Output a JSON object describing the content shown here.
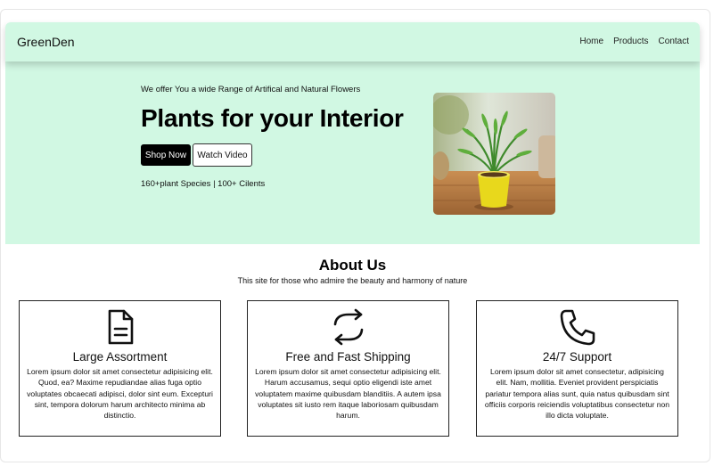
{
  "navbar": {
    "brand": "GreenDen",
    "links": [
      "Home",
      "Products",
      "Contact"
    ]
  },
  "hero": {
    "tagline": "We offer You a wide Range of Artifical and Natural Flowers",
    "title": "Plants for your Interior",
    "shop_label": "Shop Now",
    "watch_label": "Watch Video",
    "stats": "160+plant Species | 100+ Cilents"
  },
  "about": {
    "title": "About Us",
    "subtitle": "This site for those who admire the beauty and harmony of nature",
    "cards": [
      {
        "icon": "document-icon",
        "title": "Large Assortment",
        "text": "Lorem ipsum dolor sit amet consectetur adipisicing elit. Quod, ea? Maxime repudiandae alias fuga optio voluptates obcaecati adipisci, dolor sint eum. Excepturi sint, tempora dolorum harum architecto minima ab distinctio."
      },
      {
        "icon": "refresh-icon",
        "title": "Free and Fast Shipping",
        "text": "Lorem ipsum dolor sit amet consectetur adipisicing elit. Harum accusamus, sequi optio eligendi iste amet voluptatem maxime quibusdam blanditiis. A autem ipsa voluptates sit iusto rem itaque laboriosam quibusdam harum."
      },
      {
        "icon": "phone-icon",
        "title": "24/7 Support",
        "text": "Lorem ipsum dolor sit amet consectetur, adipisicing elit. Nam, mollitia. Eveniet provident perspiciatis pariatur tempora alias sunt, quia natus quibusdam sint officiis corporis reiciendis voluptatibus consectetur non illo dicta voluptate."
      }
    ]
  },
  "colors": {
    "mint": "#d1f8e3",
    "pot_yellow": "#e8d81c",
    "dark": "#000000"
  }
}
